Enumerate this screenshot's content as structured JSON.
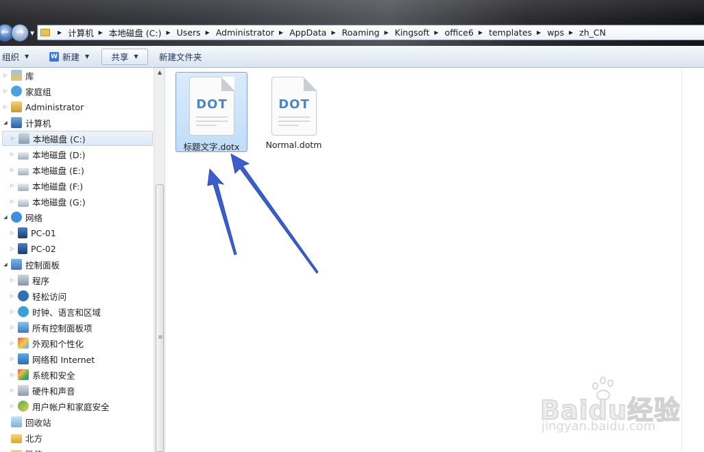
{
  "address_bar": {
    "crumbs": [
      "计算机",
      "本地磁盘 (C:)",
      "Users",
      "Administrator",
      "AppData",
      "Roaming",
      "Kingsoft",
      "office6",
      "templates",
      "wps",
      "zh_CN"
    ]
  },
  "toolbar": {
    "organize_label": "组织",
    "new_label": "新建",
    "new_icon_letter": "W",
    "share_label": "共享",
    "new_folder_label": "新建文件夹"
  },
  "sidebar": {
    "items": [
      {
        "label": "库",
        "icon": "library-icon"
      },
      {
        "label": "家庭组",
        "icon": "homegroup-icon"
      },
      {
        "label": "Administrator",
        "icon": "user-folder-icon"
      },
      {
        "label": "计算机",
        "icon": "computer-icon"
      },
      {
        "label": "本地磁盘 (C:)",
        "icon": "system-drive-icon",
        "selected": true
      },
      {
        "label": "本地磁盘 (D:)",
        "icon": "drive-icon"
      },
      {
        "label": "本地磁盘 (E:)",
        "icon": "drive-icon"
      },
      {
        "label": "本地磁盘 (F:)",
        "icon": "drive-icon"
      },
      {
        "label": "本地磁盘 (G:)",
        "icon": "drive-icon"
      },
      {
        "label": "网络",
        "icon": "network-icon"
      },
      {
        "label": "PC-01",
        "icon": "pc-icon"
      },
      {
        "label": "PC-02",
        "icon": "pc-icon"
      },
      {
        "label": "控制面板",
        "icon": "control-panel-icon"
      },
      {
        "label": "程序",
        "icon": "programs-icon"
      },
      {
        "label": "轻松访问",
        "icon": "ease-of-access-icon"
      },
      {
        "label": "时钟、语言和区域",
        "icon": "clock-language-icon"
      },
      {
        "label": "所有控制面板项",
        "icon": "all-control-panel-icon"
      },
      {
        "label": "外观和个性化",
        "icon": "appearance-icon"
      },
      {
        "label": "网络和 Internet",
        "icon": "network-internet-icon"
      },
      {
        "label": "系统和安全",
        "icon": "system-security-icon"
      },
      {
        "label": "硬件和声音",
        "icon": "hardware-sound-icon"
      },
      {
        "label": "用户帐户和家庭安全",
        "icon": "user-accounts-icon"
      },
      {
        "label": "回收站",
        "icon": "recycle-bin-icon"
      },
      {
        "label": "北方",
        "icon": "folder-icon"
      },
      {
        "label": "微信",
        "icon": "folder-icon"
      }
    ]
  },
  "files": [
    {
      "name": "标题文字.dotx",
      "icon_label": "DOT",
      "icon": "dotx-file-icon",
      "selected": true
    },
    {
      "name": "Normal.dotm",
      "icon_label": "DOT",
      "icon": "dotm-file-icon",
      "selected": false
    }
  ],
  "watermark": {
    "brand": "Baidu经验",
    "url": "jingyan.baidu.com"
  },
  "colors": {
    "selection_bg": "#c1dcf8",
    "selection_border": "#7da2ce",
    "annotation_arrow": "#3a5fcd",
    "dot_label": "#4a86c6"
  }
}
